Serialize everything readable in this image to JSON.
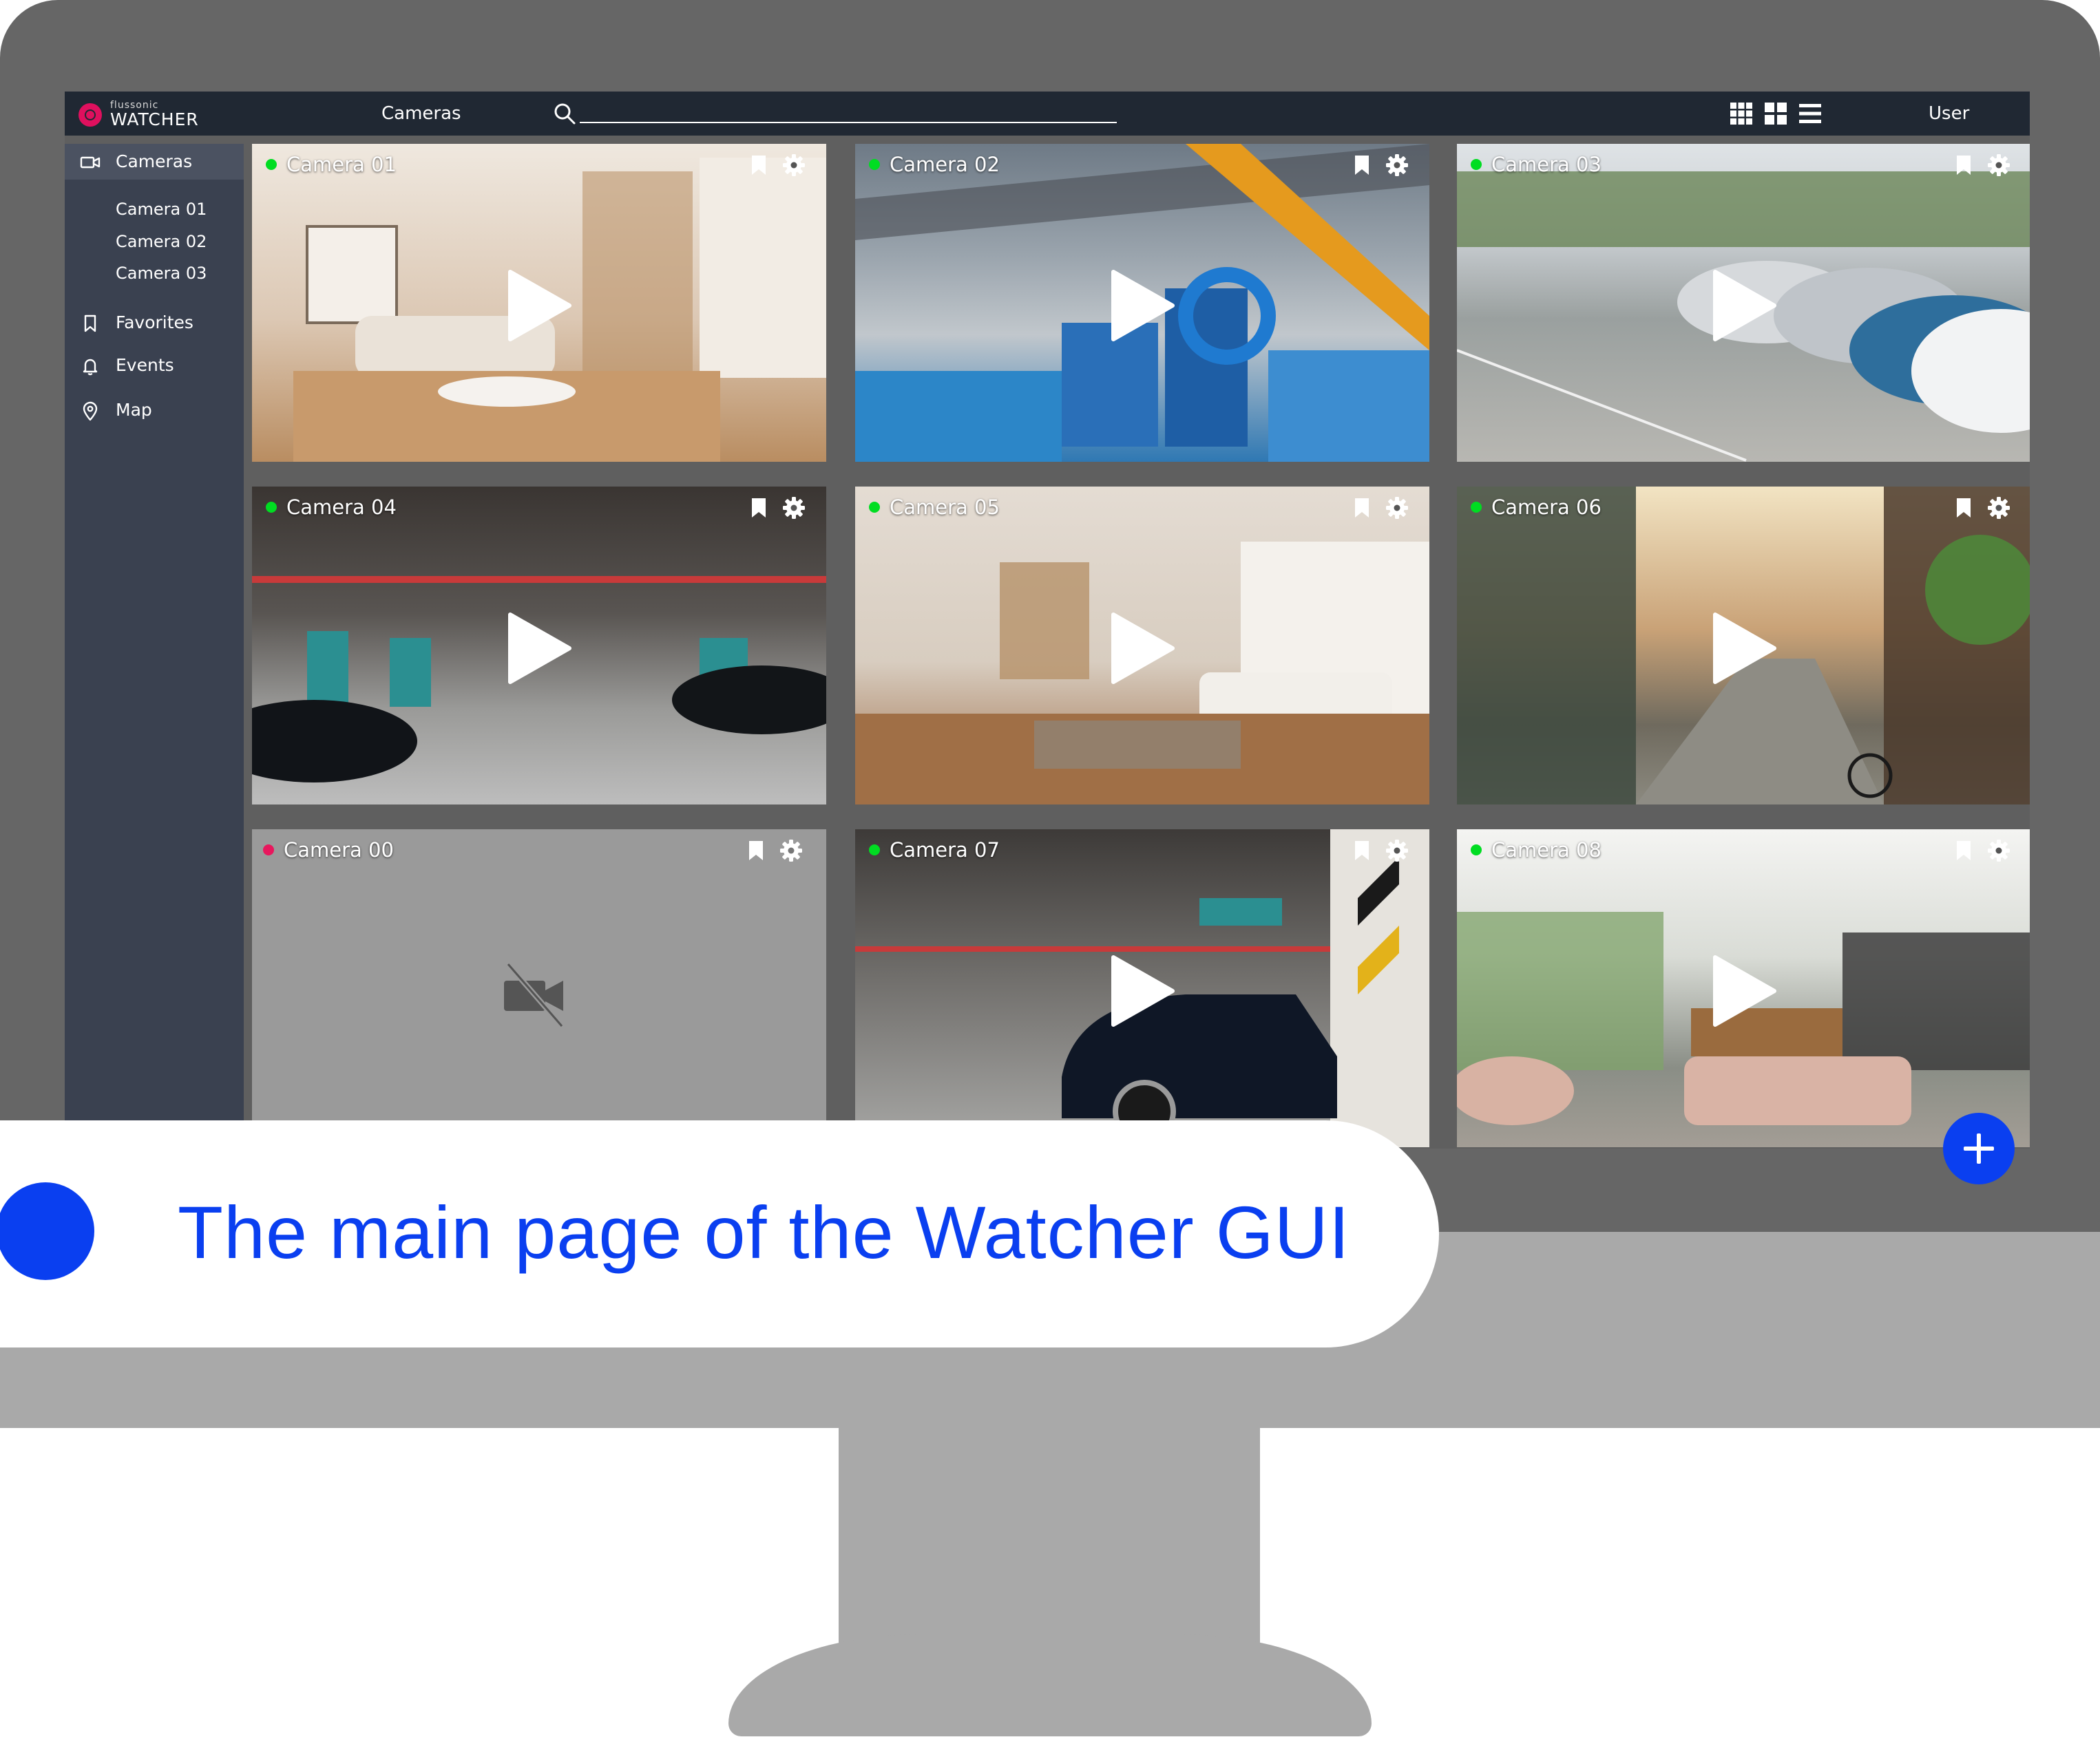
{
  "app": {
    "logo_small": "flussonic",
    "logo_big": "WATCHER",
    "page_title": "Cameras",
    "user": "User"
  },
  "search": {
    "placeholder": ""
  },
  "sidebar": {
    "cameras_label": "Cameras",
    "sub_items": [
      "Camera 01",
      "Camera 02",
      "Camera 03"
    ],
    "favorites_label": "Favorites",
    "events_label": "Events",
    "map_label": "Map"
  },
  "cameras": [
    {
      "name": "Camera 01",
      "status": "online"
    },
    {
      "name": "Camera 02",
      "status": "online"
    },
    {
      "name": "Camera 03",
      "status": "online"
    },
    {
      "name": "Camera 04",
      "status": "online"
    },
    {
      "name": "Camera 05",
      "status": "online"
    },
    {
      "name": "Camera 06",
      "status": "online"
    },
    {
      "name": "Camera 00",
      "status": "offline"
    },
    {
      "name": "Camera 07",
      "status": "online"
    },
    {
      "name": "Camera 08",
      "status": "online"
    }
  ],
  "caption": "The main page of the Watcher GUI",
  "colors": {
    "online": "#00dd22",
    "offline": "#e8175d",
    "accent": "#0a3ff0",
    "topbar": "#202833",
    "sidebar": "#3a4150"
  }
}
